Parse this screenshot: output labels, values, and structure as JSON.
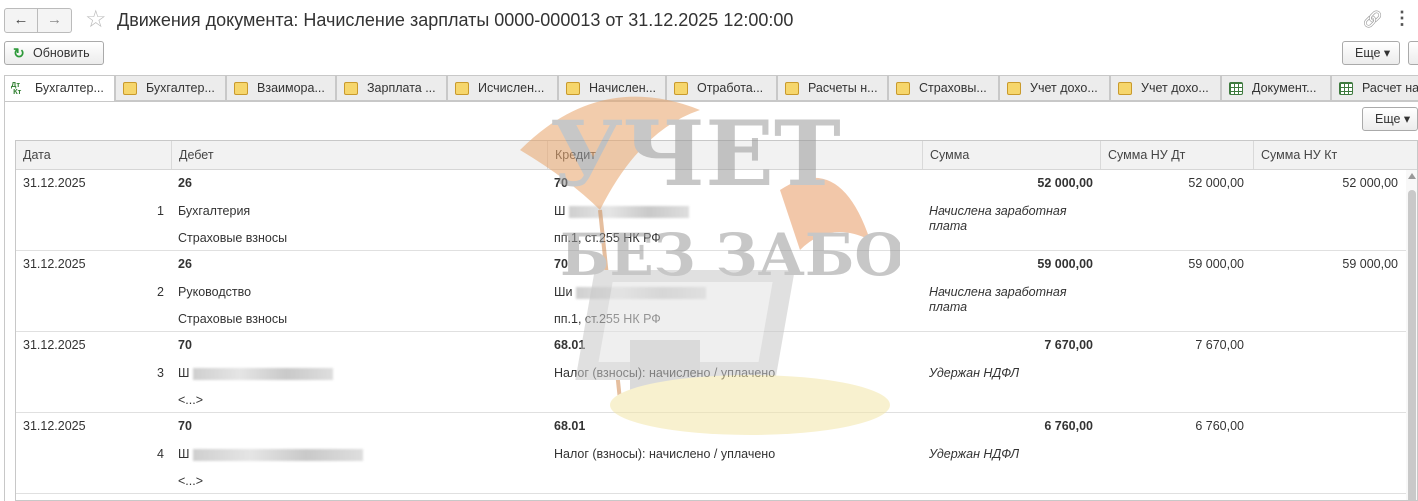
{
  "window": {
    "title": "Движения документа: Начисление зарплаты 0000-000013 от 31.12.2025 12:00:00"
  },
  "nav": {
    "back": "←",
    "forward": "→",
    "link_icon": "link-icon",
    "more_icon": "⋮"
  },
  "toolbar": {
    "refresh_label": "Обновить",
    "more_label": "Еще",
    "refresh_icon": "refresh-icon"
  },
  "tabs": [
    {
      "label": "Бухгалтер...",
      "icon": "dtkt-icon",
      "active": true
    },
    {
      "label": "Бухгалтер...",
      "icon": "register-icon",
      "active": false
    },
    {
      "label": "Взаимора...",
      "icon": "register-icon",
      "active": false
    },
    {
      "label": "Зарплата ...",
      "icon": "register-icon",
      "active": false
    },
    {
      "label": "Исчислен...",
      "icon": "register-icon",
      "active": false
    },
    {
      "label": "Начислен...",
      "icon": "register-icon",
      "active": false
    },
    {
      "label": "Отработа...",
      "icon": "register-icon",
      "active": false
    },
    {
      "label": "Расчеты н...",
      "icon": "register-icon",
      "active": false
    },
    {
      "label": "Страховы...",
      "icon": "register-icon",
      "active": false
    },
    {
      "label": "Учет дохо...",
      "icon": "register-icon",
      "active": false
    },
    {
      "label": "Учет дохо...",
      "icon": "register-icon",
      "active": false
    },
    {
      "label": "Документ...",
      "icon": "grid-icon",
      "active": false
    },
    {
      "label": "Расчет на...",
      "icon": "grid-icon",
      "active": false
    }
  ],
  "panel": {
    "more_label": "Еще"
  },
  "table": {
    "columns": [
      "Дата",
      "Дебет",
      "Кредит",
      "Сумма",
      "Сумма НУ Дт",
      "Сумма НУ Кт"
    ],
    "rows": [
      {
        "date": "31.12.2025",
        "num": "1",
        "debit_account": "26",
        "debit_sub1": "Бухгалтерия",
        "debit_sub2": "Страховые взносы",
        "credit_account": "70",
        "credit_sub1": "Ш",
        "credit_sub2": "пп.1, ст.255 НК РФ",
        "amount": "52 000,00",
        "content": "Начислена заработная плата",
        "nu_dt": "52 000,00",
        "nu_kt": "52 000,00"
      },
      {
        "date": "31.12.2025",
        "num": "2",
        "debit_account": "26",
        "debit_sub1": "Руководство",
        "debit_sub2": "Страховые взносы",
        "credit_account": "70",
        "credit_sub1": "Ши",
        "credit_sub2": "пп.1, ст.255 НК РФ",
        "amount": "59 000,00",
        "content": "Начислена заработная плата",
        "nu_dt": "59 000,00",
        "nu_kt": "59 000,00"
      },
      {
        "date": "31.12.2025",
        "num": "3",
        "debit_account": "70",
        "debit_sub1": "Ш",
        "debit_sub2": "<...>",
        "credit_account": "68.01",
        "credit_sub1": "Налог (взносы): начислено / уплачено",
        "credit_sub2": "",
        "amount": "7 670,00",
        "content": "Удержан НДФЛ",
        "nu_dt": "7 670,00",
        "nu_kt": ""
      },
      {
        "date": "31.12.2025",
        "num": "4",
        "debit_account": "70",
        "debit_sub1": "Ш",
        "debit_sub2": "<...>",
        "credit_account": "68.01",
        "credit_sub1": "Налог (взносы): начислено / уплачено",
        "credit_sub2": "",
        "amount": "6 760,00",
        "content": "Удержан НДФЛ",
        "nu_dt": "6 760,00",
        "nu_kt": ""
      }
    ]
  },
  "watermark": {
    "line1": "УЧЕТ",
    "line2": "БЕЗ ЗАБОТ"
  }
}
